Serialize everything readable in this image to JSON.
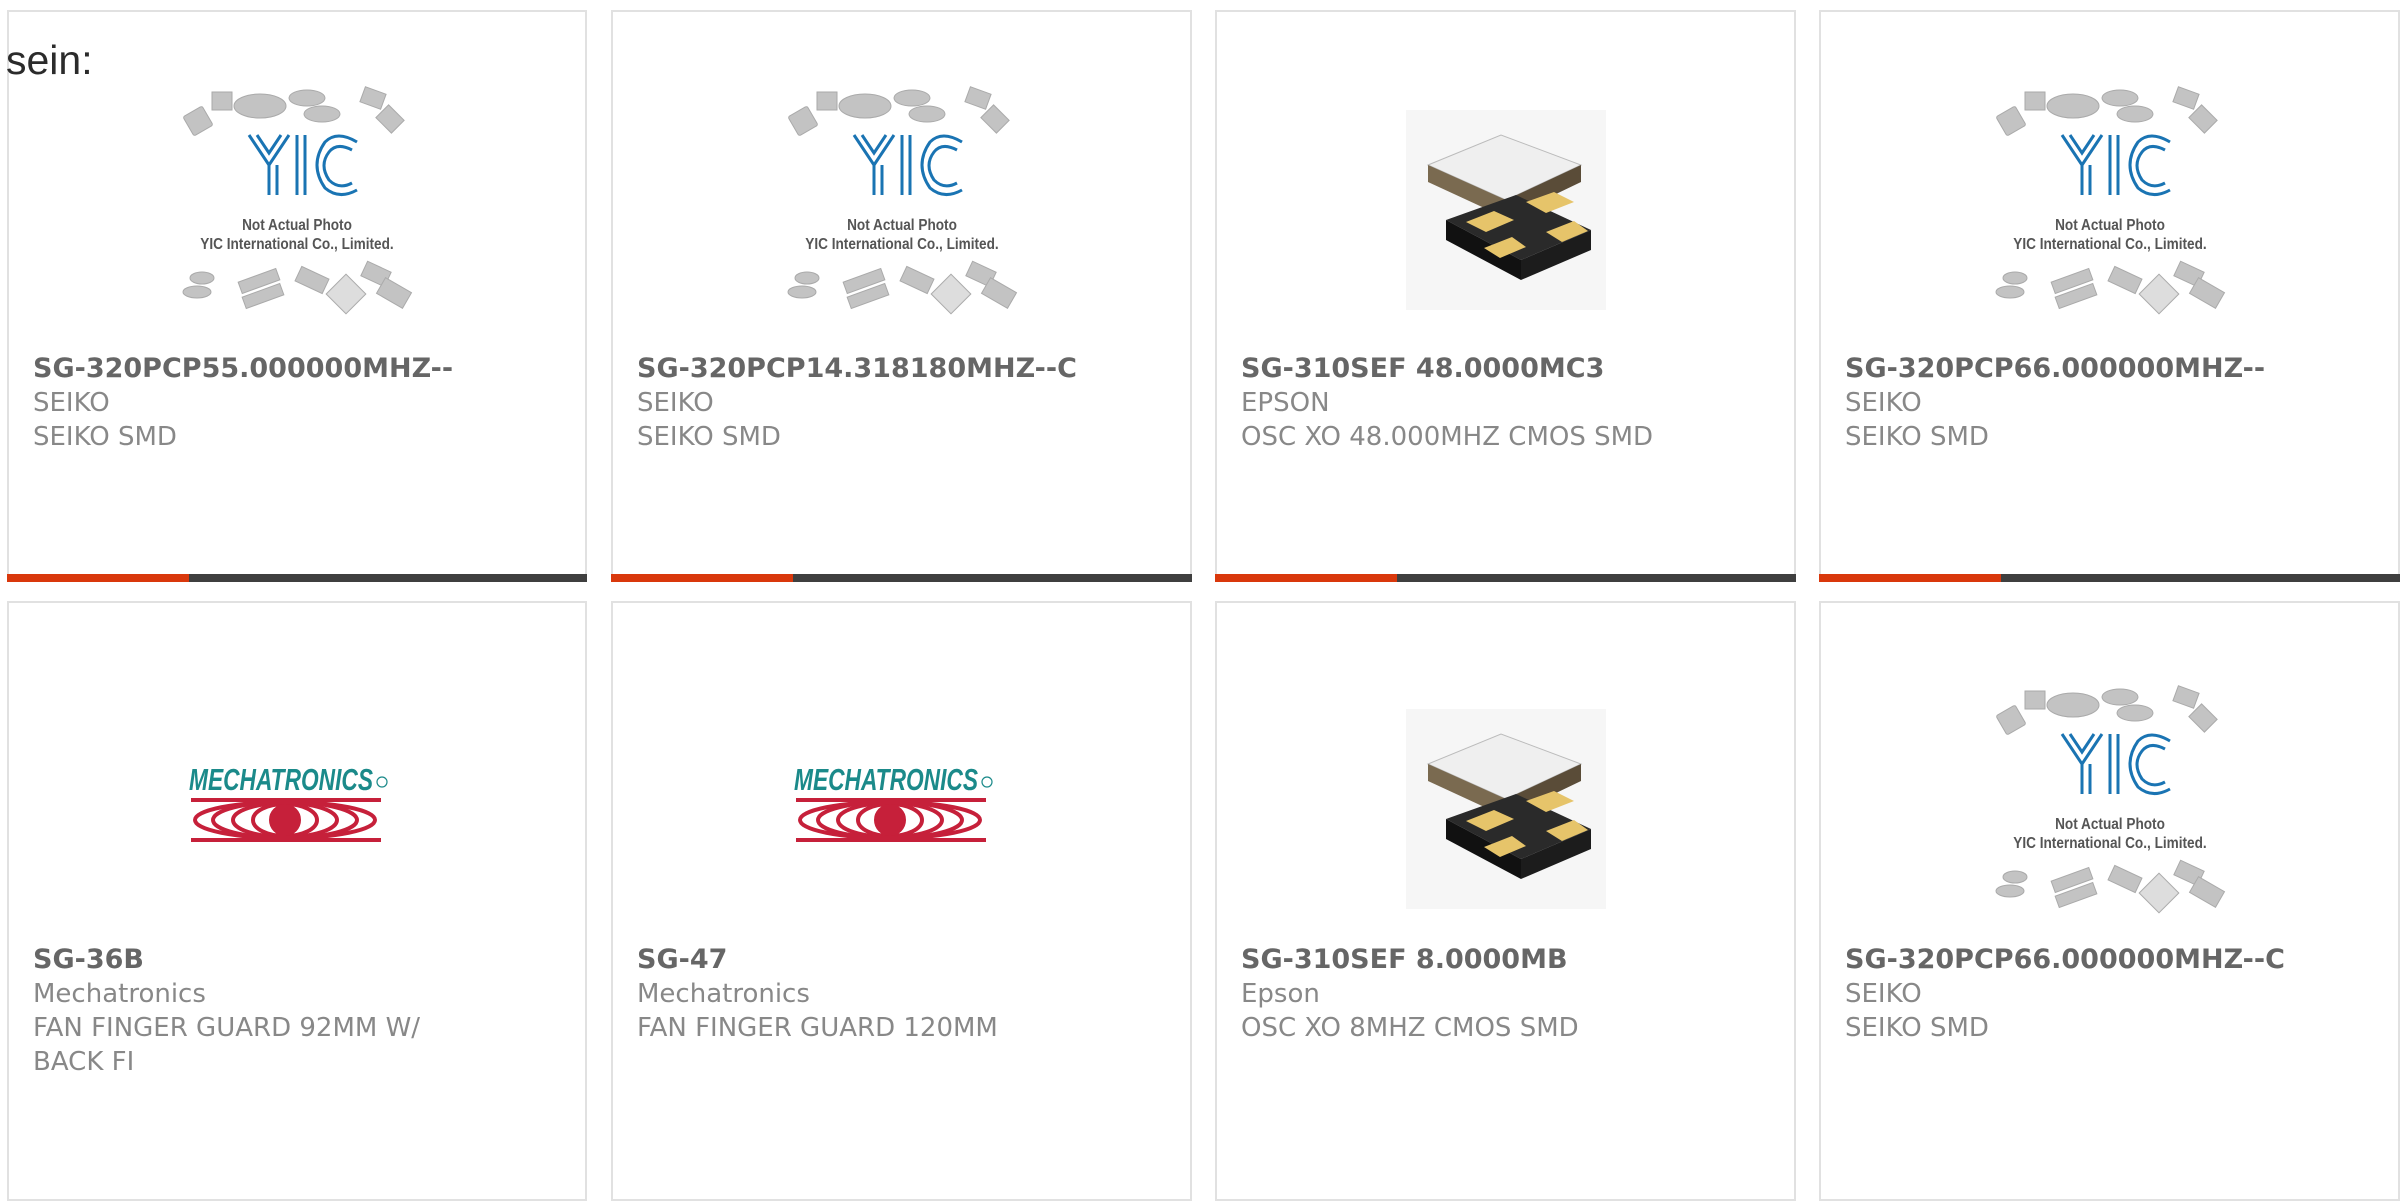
{
  "page": {
    "leading_text": "sein:"
  },
  "brand_colors": {
    "accent": "#d9380c",
    "bar": "#3f3f3f",
    "card_border": "#e1e1e1"
  },
  "placeholder": {
    "logo_text": "YIC",
    "note_line1": "Not Actual Photo",
    "note_line2": "YIC International Co., Limited."
  },
  "mechatronics_logo_text": "MECHATRONICS",
  "products": [
    {
      "part": "SG-320PCP55.000000MHZ--",
      "manufacturer": "SEIKO",
      "description": "SEIKO SMD",
      "image": "yic-placeholder"
    },
    {
      "part": "SG-320PCP14.318180MHZ--C",
      "manufacturer": "SEIKO",
      "description": "SEIKO SMD",
      "image": "yic-placeholder"
    },
    {
      "part": "SG-310SEF 48.0000MC3",
      "manufacturer": "EPSON",
      "description": "OSC XO 48.000MHZ CMOS SMD",
      "image": "crystal-oscillator"
    },
    {
      "part": "SG-320PCP66.000000MHZ--",
      "manufacturer": "SEIKO",
      "description": "SEIKO SMD",
      "image": "yic-placeholder"
    },
    {
      "part": "SG-36B",
      "manufacturer": "Mechatronics",
      "description": "FAN FINGER GUARD 92MM W/ BACK FI",
      "image": "mechatronics-logo"
    },
    {
      "part": "SG-47",
      "manufacturer": "Mechatronics",
      "description": "FAN FINGER GUARD 120MM",
      "image": "mechatronics-logo"
    },
    {
      "part": "SG-310SEF 8.0000MB",
      "manufacturer": "Epson",
      "description": "OSC XO 8MHZ CMOS SMD",
      "image": "crystal-oscillator"
    },
    {
      "part": "SG-320PCP66.000000MHZ--C",
      "manufacturer": "SEIKO",
      "description": "SEIKO SMD",
      "image": "yic-placeholder"
    }
  ]
}
